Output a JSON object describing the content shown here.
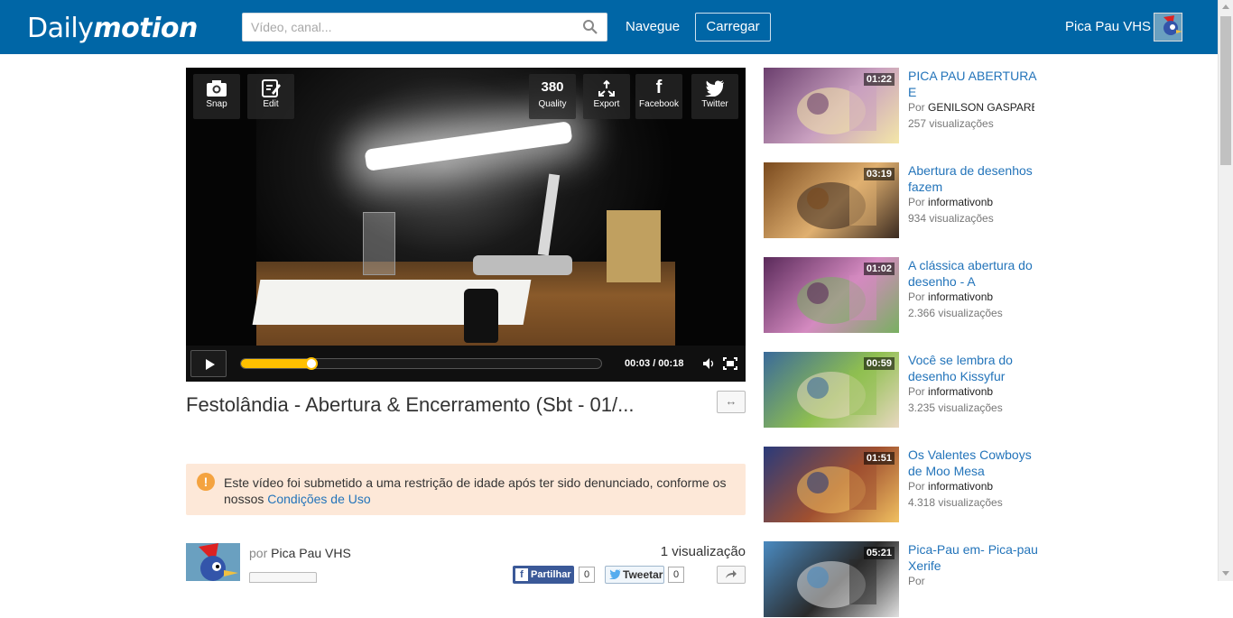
{
  "header": {
    "logo_text_light": "Daily",
    "logo_text_bold": "motion",
    "search_placeholder": "Vídeo, canal...",
    "search_icon": "magnifier-icon",
    "nav_label": "Navegue",
    "upload_label": "Carregar",
    "user_name": "Pica Pau VHS",
    "brand_color": "#0066a6"
  },
  "player": {
    "top_buttons_left": [
      {
        "icon": "camera-icon",
        "label": "Snap"
      },
      {
        "icon": "edit-icon",
        "label": "Edit"
      }
    ],
    "top_buttons_right": [
      {
        "icon_text": "380",
        "label": "Quality"
      },
      {
        "icon": "export-icon",
        "label": "Export"
      },
      {
        "icon": "facebook-icon",
        "label": "Facebook"
      },
      {
        "icon": "twitter-icon",
        "label": "Twitter"
      }
    ],
    "time": "00:03 / 00:18",
    "progress_fraction": 0.18,
    "progress_color": "#ffc000"
  },
  "video": {
    "title": "Festolândia - Abertura & Encerramento (Sbt - 01/...",
    "expand_label": "↔",
    "warning_text": "Este vídeo foi submetido a uma restrição de idade após ter sido denunciado, conforme os nossos ",
    "warning_link": "Condições de Uso",
    "owner_prefix": "por",
    "owner_name": "Pica Pau VHS",
    "views_total": "1 visualização",
    "fb_label": "Partilhar",
    "fb_count": "0",
    "tw_label": "Tweetar",
    "tw_count": "0"
  },
  "related": [
    {
      "duration": "01:22",
      "title": "PICA PAU ABERTURA E",
      "by_prefix": "Por",
      "channel": "GENILSON GASPARE",
      "views": "257 visualizações"
    },
    {
      "duration": "03:19",
      "title": "Abertura de desenhos fazem",
      "by_prefix": "Por",
      "channel": "informativonb",
      "views": "934 visualizações"
    },
    {
      "duration": "01:02",
      "title": "A clássica abertura do desenho - A",
      "by_prefix": "Por",
      "channel": "informativonb",
      "views": "2.366 visualizações"
    },
    {
      "duration": "00:59",
      "title": "Você se lembra do desenho Kissyfur",
      "by_prefix": "Por",
      "channel": "informativonb",
      "views": "3.235 visualizações"
    },
    {
      "duration": "01:51",
      "title": "Os Valentes Cowboys de Moo Mesa",
      "by_prefix": "Por",
      "channel": "informativonb",
      "views": "4.318 visualizações"
    },
    {
      "duration": "05:21",
      "title": "Pica-Pau em- Pica-pau Xerife",
      "by_prefix": "Por",
      "channel": "",
      "views": ""
    }
  ]
}
